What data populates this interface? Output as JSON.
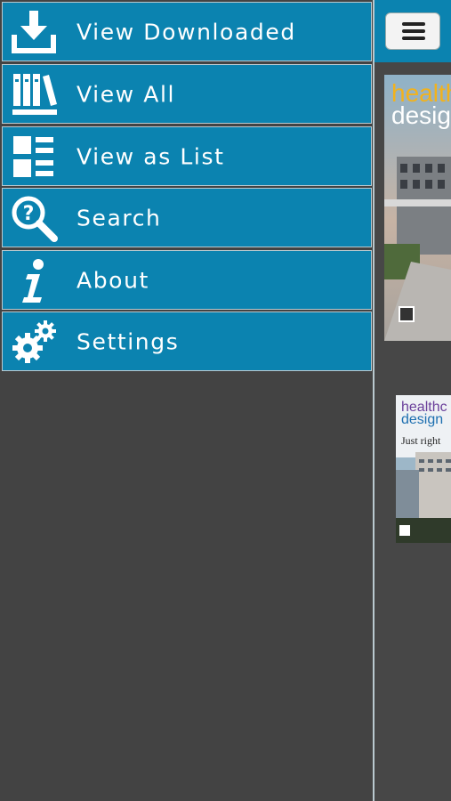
{
  "menu": {
    "items": [
      {
        "label": "View Downloaded",
        "icon": "download-icon"
      },
      {
        "label": "View All",
        "icon": "bookshelf-icon"
      },
      {
        "label": "View as List",
        "icon": "list-view-icon"
      },
      {
        "label": "Search",
        "icon": "search-icon"
      },
      {
        "label": "About",
        "icon": "info-icon"
      },
      {
        "label": "Settings",
        "icon": "gears-icon"
      }
    ]
  },
  "content": {
    "menu_button_icon": "hamburger-icon",
    "covers": [
      {
        "brand_line1": "health",
        "brand_line2": "design"
      },
      {
        "brand_line1": "healthc",
        "brand_line2": "design",
        "tagline": "Just right"
      }
    ]
  },
  "colors": {
    "menu_background": "#0b83b0",
    "menu_border": "#b9c9cf",
    "panel_background": "#434343",
    "text": "#ffffff"
  }
}
